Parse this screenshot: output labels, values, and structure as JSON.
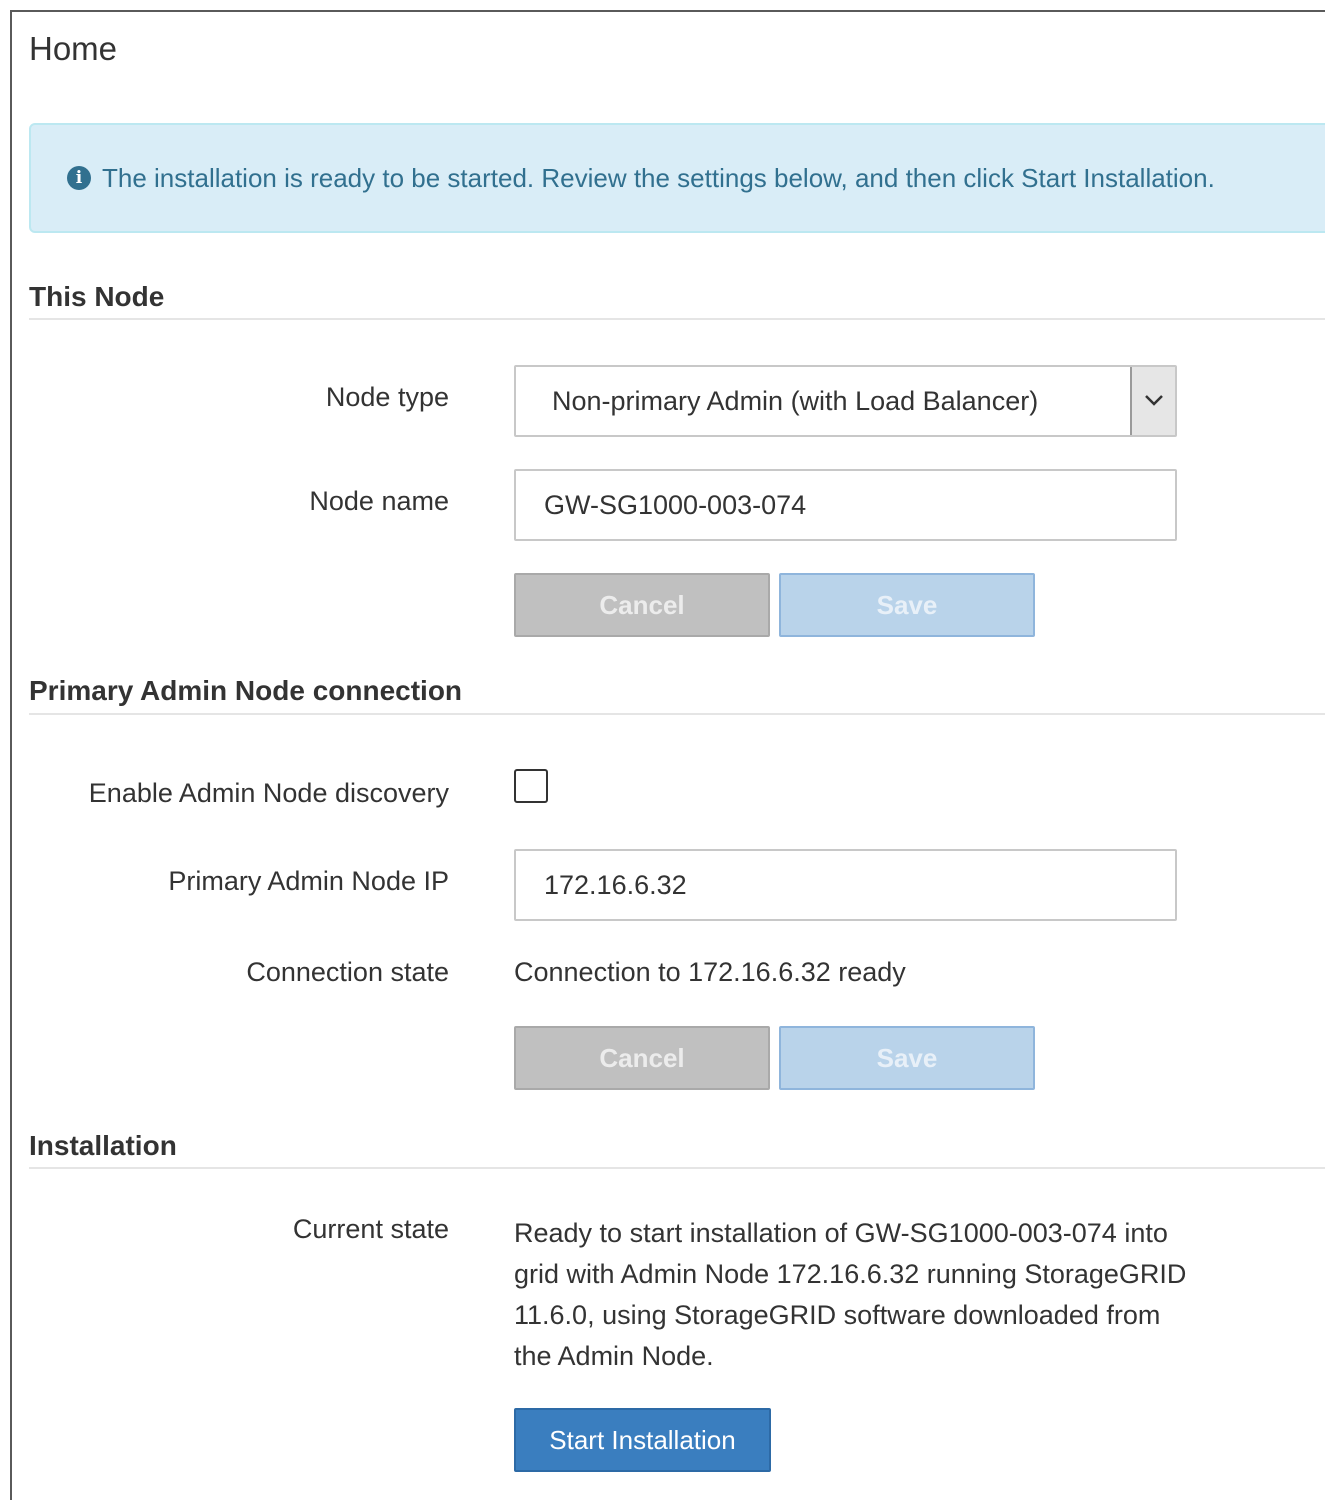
{
  "page": {
    "title": "Home"
  },
  "alert": {
    "icon": "info-icon",
    "icon_glyph": "i",
    "message": "The installation is ready to be started. Review the settings below, and then click Start Installation."
  },
  "this_node": {
    "heading": "This Node",
    "node_type_label": "Node type",
    "node_type_value": "Non-primary Admin (with Load Balancer)",
    "node_name_label": "Node name",
    "node_name_value": "GW-SG1000-003-074",
    "cancel_label": "Cancel",
    "save_label": "Save"
  },
  "primary_admin": {
    "heading": "Primary Admin Node connection",
    "discovery_label": "Enable Admin Node discovery",
    "discovery_checked": false,
    "ip_label": "Primary Admin Node IP",
    "ip_value": "172.16.6.32",
    "connection_state_label": "Connection state",
    "connection_state_value": "Connection to 172.16.6.32 ready",
    "cancel_label": "Cancel",
    "save_label": "Save"
  },
  "installation": {
    "heading": "Installation",
    "current_state_label": "Current state",
    "current_state_value": "Ready to start installation of GW-SG1000-003-074 into grid with Admin Node 172.16.6.32 running StorageGRID 11.6.0, using StorageGRID software downloaded from the Admin Node.",
    "start_label": "Start Installation"
  },
  "colors": {
    "alert_bg": "#d9edf7",
    "alert_text": "#31708f",
    "primary_button": "#3a7ebf",
    "disabled_cancel": "#c0c0c0",
    "disabled_save": "#b9d3ea"
  }
}
